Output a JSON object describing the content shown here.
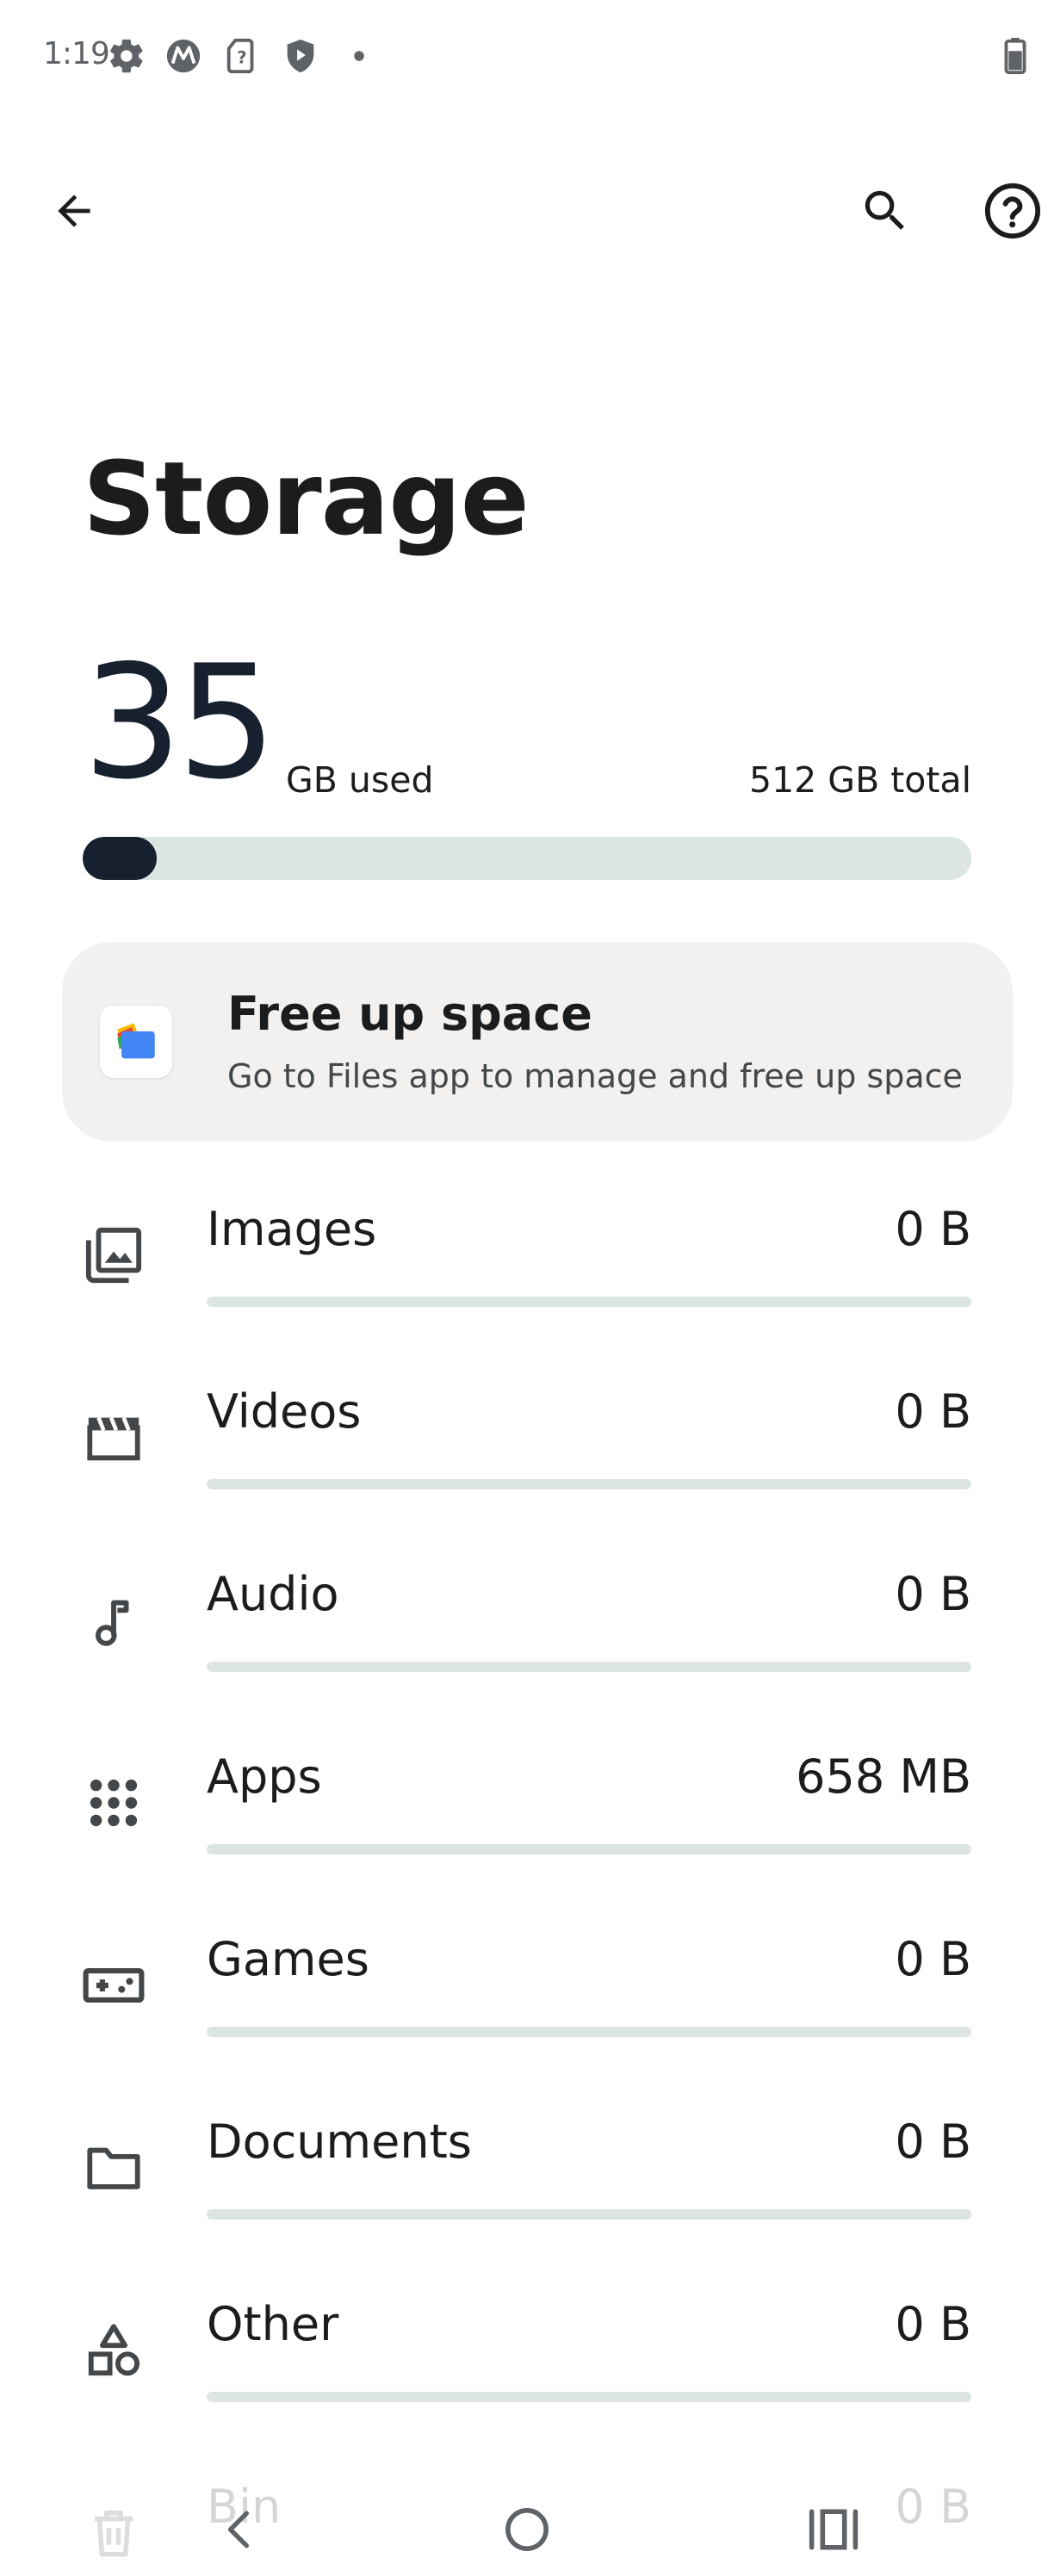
{
  "status_bar": {
    "time": "1:19",
    "icons": [
      "settings-gear-icon",
      "motorola-logo-icon",
      "sim-card-unknown-icon",
      "shield-play-icon",
      "notification-dot-icon",
      "battery-icon"
    ]
  },
  "app_bar": {
    "back_icon": "arrow-back-icon",
    "search_icon": "search-icon",
    "help_icon": "help-circle-icon"
  },
  "page": {
    "title": "Storage"
  },
  "usage": {
    "used_value": "35",
    "used_unit": "GB used",
    "total_text": "512 GB total",
    "used_fraction": 0.068
  },
  "free_up_card": {
    "title": "Free up space",
    "subtitle": "Go to Files app to manage and free up space",
    "icon": "files-app-icon"
  },
  "categories": [
    {
      "label": "Images",
      "size": "0 B",
      "icon": "images-icon",
      "fraction": 0
    },
    {
      "label": "Videos",
      "size": "0 B",
      "icon": "videos-icon",
      "fraction": 0
    },
    {
      "label": "Audio",
      "size": "0 B",
      "icon": "audio-icon",
      "fraction": 0
    },
    {
      "label": "Apps",
      "size": "658 MB",
      "icon": "apps-icon",
      "fraction": 0
    },
    {
      "label": "Games",
      "size": "0 B",
      "icon": "games-icon",
      "fraction": 0
    },
    {
      "label": "Documents",
      "size": "0 B",
      "icon": "documents-icon",
      "fraction": 0
    },
    {
      "label": "Other",
      "size": "0 B",
      "icon": "other-icon",
      "fraction": 0
    },
    {
      "label": "Bin",
      "size": "0 B",
      "icon": "trash-icon",
      "fraction": 0
    }
  ],
  "nav_bar": {
    "back_icon": "nav-back-icon",
    "home_icon": "nav-home-icon",
    "recents_icon": "nav-recents-icon"
  },
  "colors": {
    "accent_dark": "#17202e",
    "track": "#dce5e2",
    "card_background": "#f2f1ef",
    "text_primary": "#1b1c1e",
    "text_secondary": "#44474a"
  }
}
